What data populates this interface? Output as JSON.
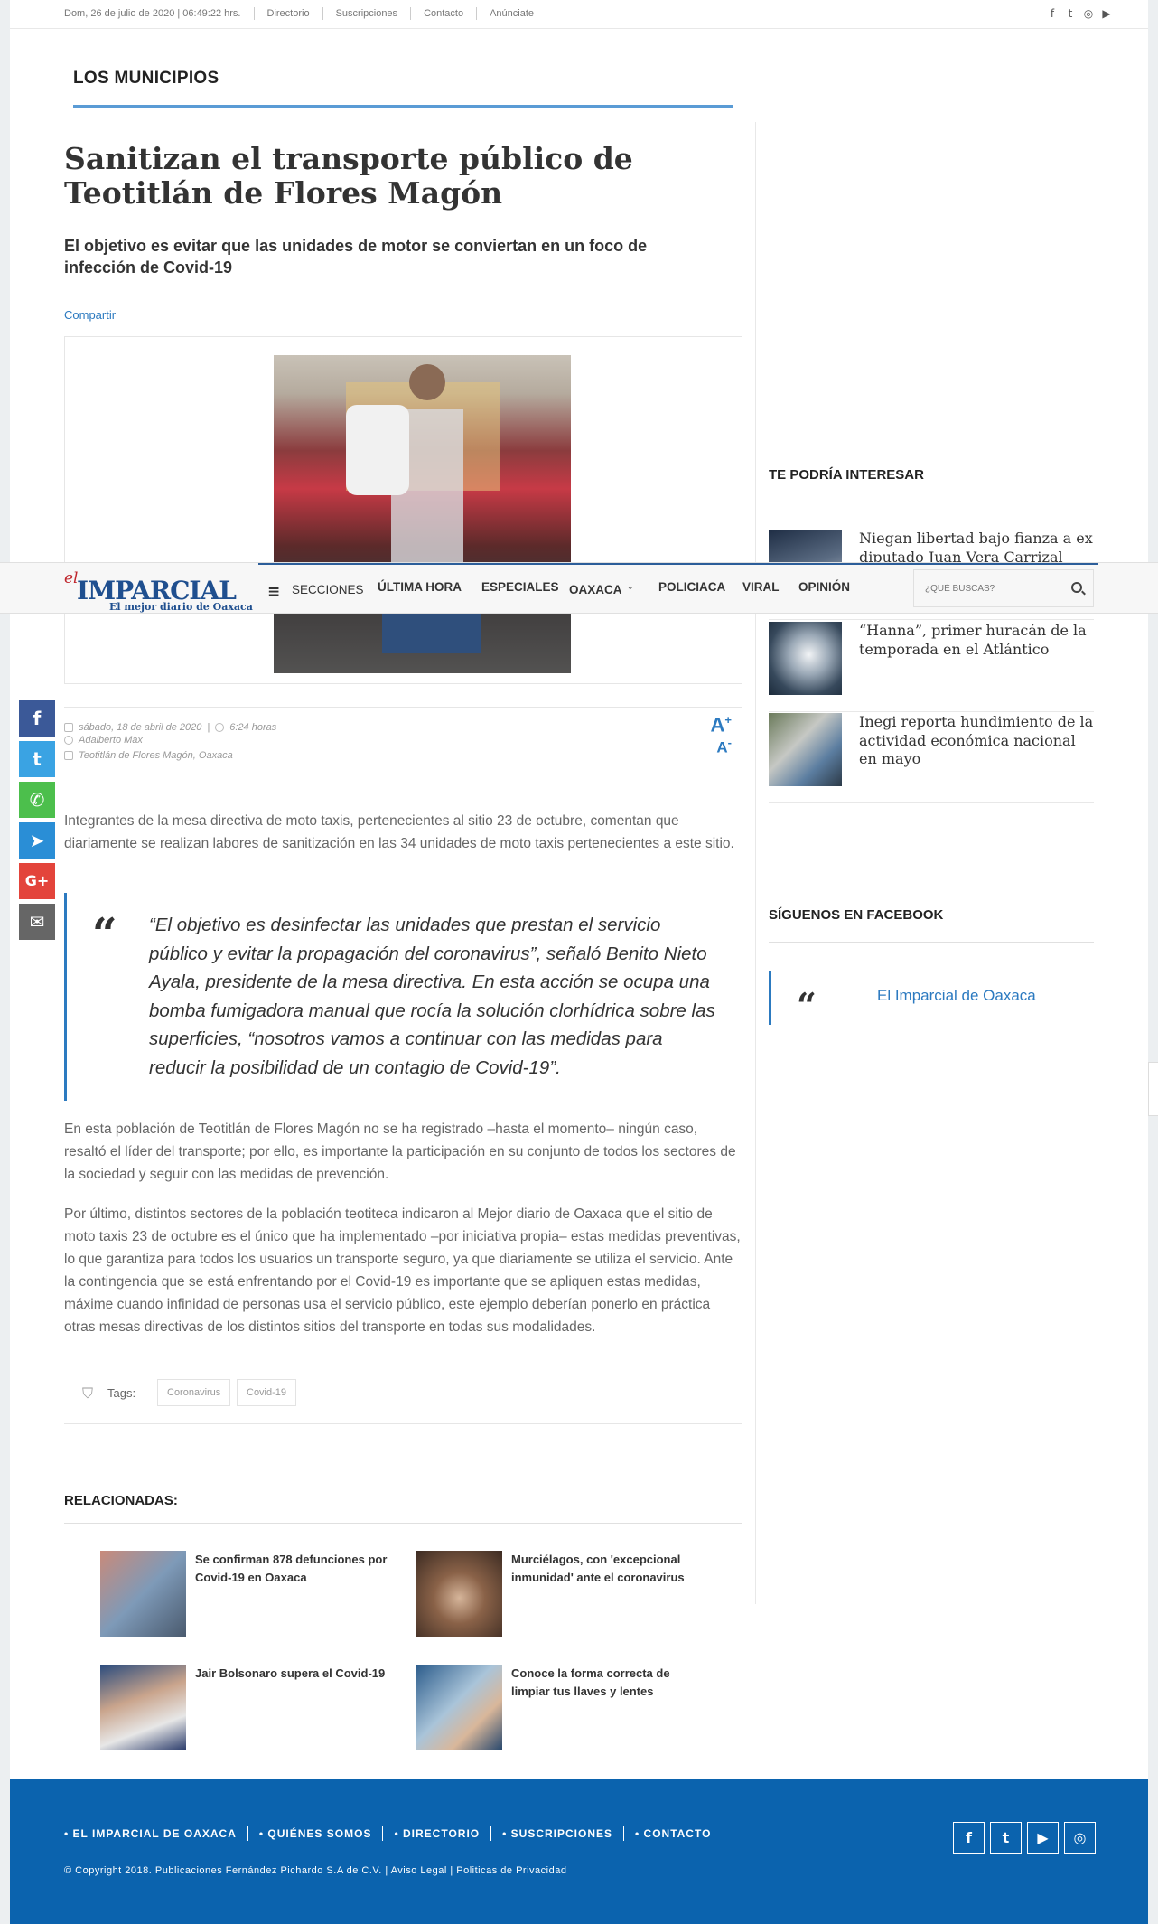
{
  "topbar": {
    "links": [
      "Dom, 26 de julio de 2020 | 06:49:22 hrs.",
      "Directorio",
      "Suscripciones",
      "Contacto",
      "Anúnciate"
    ],
    "social": [
      "f",
      "t",
      "◎",
      "▶"
    ]
  },
  "section": "LOS MUNICIPIOS",
  "article": {
    "title": "Sanitizan el transporte público de Teotitlán de Flores Magón",
    "subtitle": "El objetivo es evitar que las unidades de motor se conviertan en un foco de infección de Covid-19",
    "share": "Compartir",
    "date": "sábado, 18 de abril de 2020",
    "time": "6:24 horas",
    "author": "Adalberto Max",
    "location": "Teotitlán de Flores Magón, Oaxaca",
    "font_inc": "A",
    "font_dec": "A",
    "para1": "Integrantes de la mesa directiva de moto taxis, pertenecientes al sitio 23 de octubre, comentan que diariamente se realizan labores de sanitización en las 34 unidades de moto taxis pertenecientes a este sitio.",
    "quote_mark": "“",
    "quote": "“El objetivo es desinfectar las unidades que prestan el servicio público y evitar la propagación del coronavirus”, señaló Benito Nieto Ayala, presidente de la mesa directiva. En esta acción se ocupa una bomba fumigadora manual que rocía la solución clorhídrica sobre las superficies, “nosotros vamos a continuar con las medidas para reducir la posibilidad de un contagio de Covid-19”.",
    "para2": "En esta población de Teotitlán de Flores Magón no se ha registrado –hasta el momento– ningún caso, resaltó el líder del transporte; por ello, es importante la participación en su conjunto de todos los sectores de la sociedad y seguir con las medidas de prevención.",
    "para3": "Por último, distintos sectores de la población teotiteca indicaron al Mejor diario de Oaxaca que el sitio de moto taxis 23 de octubre es el único que ha implementado –por iniciativa propia– estas medidas preventivas, lo que garantiza para todos los usuarios un transporte seguro, ya que diariamente se utiliza el servicio. Ante la contingencia que se está enfrentando por el Covid-19 es importante que se apliquen estas medidas, máxime cuando infinidad de personas usa el servicio público, este ejemplo deberían ponerlo en práctica otras mesas directivas de los distintos sitios del transporte en todas sus modalidades.",
    "tags_label": "Tags:",
    "tags": [
      "Coronavirus",
      "Covid-19"
    ]
  },
  "related": {
    "title": "RELACIONADAS:",
    "items": [
      {
        "title": "Se confirman 878 defunciones por Covid-19 en Oaxaca"
      },
      {
        "title": "Murciélagos, con 'excepcional inmunidad' ante el coronavirus"
      },
      {
        "title": "Jair Bolsonaro supera el Covid-19"
      },
      {
        "title": "Conoce la forma correcta de limpiar tus llaves y lentes"
      }
    ]
  },
  "sidebar": {
    "interest_title": "TE PODRÍA INTERESAR",
    "items": [
      {
        "title": "Niegan libertad bajo fianza a ex diputado Juan Vera Carrizal"
      },
      {
        "title": "“Hanna”, primer huracán de la temporada en el Atlántico"
      },
      {
        "title": "Inegi reporta hundimiento de la actividad económica nacional en mayo"
      }
    ],
    "facebook_title": "SÍGUENOS EN FACEBOOK",
    "facebook_mark": "“",
    "facebook_link": "El Imparcial de Oaxaca"
  },
  "navbar": {
    "logo_el": "el",
    "logo_name": "IMPARCIAL",
    "logo_tagline": "El mejor diario de Oaxaca",
    "sections_icon": "≡",
    "items": [
      "SECCIONES",
      "ÚLTIMA HORA",
      "ESPECIALES",
      "OAXACA",
      "POLICIACA",
      "VIRAL",
      "OPINIÓN"
    ],
    "search_placeholder": "¿QUÉ BUSCAS?"
  },
  "sharebar": [
    "f",
    "t",
    "✆",
    "➤",
    "G+",
    "✉"
  ],
  "colors": {
    "accent": "#2c7ac0",
    "footer": "#0b63ae",
    "facebook": "#3b5998",
    "twitter": "#3aa3e3",
    "whatsapp": "#4cbf4c",
    "telegram": "#2a8ed6",
    "googleplus": "#e3443b",
    "email": "#666666"
  },
  "footer": {
    "menu": [
      "• EL IMPARCIAL DE OAXACA",
      "• QUIÉNES SOMOS",
      "• DIRECTORIO",
      "• SUSCRIPCIONES",
      "• CONTACTO"
    ],
    "copyright": "© Copyright 2018. Publicaciones Fernández Pichardo S.A de C.V. | Aviso Legal | Politicas de Privacidad",
    "social": [
      "f",
      "t",
      "▶",
      "◎"
    ]
  }
}
